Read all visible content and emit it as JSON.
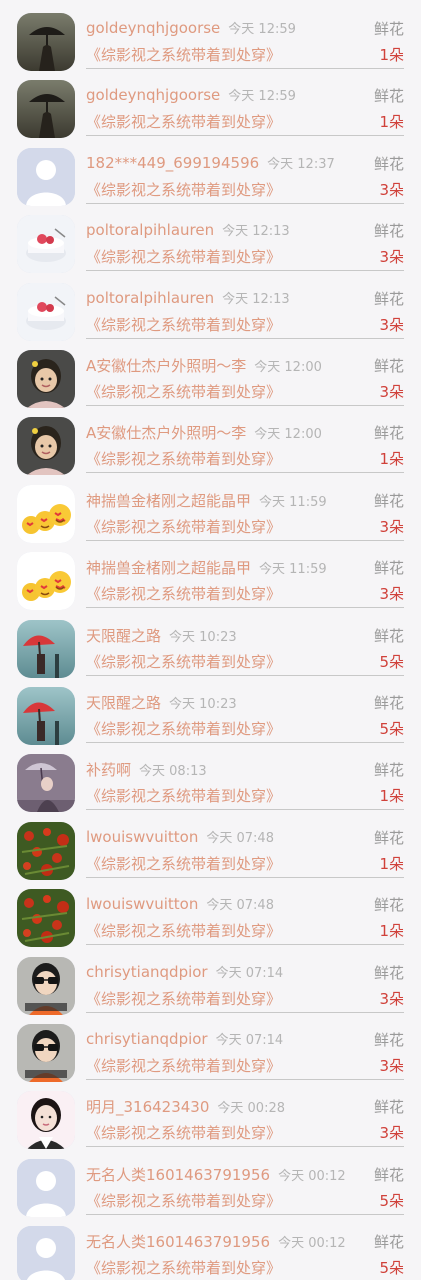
{
  "gift_label": "鲜花",
  "rows": [
    {
      "avatar": "avatar-umbrella-dark",
      "name": "goldeynqhjgoorse",
      "time": "今天 12:59",
      "book": "《综影视之系统带着到处穿》",
      "count": "1朵"
    },
    {
      "avatar": "avatar-umbrella-dark",
      "name": "goldeynqhjgoorse",
      "time": "今天 12:59",
      "book": "《综影视之系统带着到处穿》",
      "count": "1朵"
    },
    {
      "avatar": "avatar-default",
      "name": "182***449_699194596",
      "time": "今天 12:37",
      "book": "《综影视之系统带着到处穿》",
      "count": "3朵"
    },
    {
      "avatar": "avatar-cake",
      "name": "poltoralpihlauren",
      "time": "今天 12:13",
      "book": "《综影视之系统带着到处穿》",
      "count": "3朵"
    },
    {
      "avatar": "avatar-cake",
      "name": "poltoralpihlauren",
      "time": "今天 12:13",
      "book": "《综影视之系统带着到处穿》",
      "count": "3朵"
    },
    {
      "avatar": "avatar-girl-portrait",
      "name": "A安徽仕杰户外照明～李",
      "time": "今天 12:00",
      "book": "《综影视之系统带着到处穿》",
      "count": "3朵"
    },
    {
      "avatar": "avatar-girl-portrait",
      "name": "A安徽仕杰户外照明～李",
      "time": "今天 12:00",
      "book": "《综影视之系统带着到处穿》",
      "count": "1朵"
    },
    {
      "avatar": "avatar-emoji",
      "name": "神揣兽金楮刚之超能晶甲",
      "time": "今天 11:59",
      "book": "《综影视之系统带着到处穿》",
      "count": "3朵"
    },
    {
      "avatar": "avatar-emoji",
      "name": "神揣兽金楮刚之超能晶甲",
      "time": "今天 11:59",
      "book": "《综影视之系统带着到处穿》",
      "count": "3朵"
    },
    {
      "avatar": "avatar-red-umbrella",
      "name": "天限醒之路",
      "time": "今天 10:23",
      "book": "《综影视之系统带着到处穿》",
      "count": "5朵"
    },
    {
      "avatar": "avatar-red-umbrella",
      "name": "天限醒之路",
      "time": "今天 10:23",
      "book": "《综影视之系统带着到处穿》",
      "count": "5朵"
    },
    {
      "avatar": "avatar-lady-umbrella",
      "name": "补药啊",
      "time": "今天 08:13",
      "book": "《综影视之系统带着到处穿》",
      "count": "1朵"
    },
    {
      "avatar": "avatar-red-flowers",
      "name": "lwouiswvuitton",
      "time": "今天 07:48",
      "book": "《综影视之系统带着到处穿》",
      "count": "1朵"
    },
    {
      "avatar": "avatar-red-flowers",
      "name": "lwouiswvuitton",
      "time": "今天 07:48",
      "book": "《综影视之系统带着到处穿》",
      "count": "1朵"
    },
    {
      "avatar": "avatar-sunglasses",
      "name": "chrisytianqdpior",
      "time": "今天 07:14",
      "book": "《综影视之系统带着到处穿》",
      "count": "3朵"
    },
    {
      "avatar": "avatar-sunglasses",
      "name": "chrisytianqdpior",
      "time": "今天 07:14",
      "book": "《综影视之系统带着到处穿》",
      "count": "3朵"
    },
    {
      "avatar": "avatar-girl-white",
      "name": "明月_316423430",
      "time": "今天 00:28",
      "book": "《综影视之系统带着到处穿》",
      "count": "3朵"
    },
    {
      "avatar": "avatar-default",
      "name": "无名人类1601463791956",
      "time": "今天 00:12",
      "book": "《综影视之系统带着到处穿》",
      "count": "5朵"
    },
    {
      "avatar": "avatar-default",
      "name": "无名人类1601463791956",
      "time": "今天 00:12",
      "book": "《综影视之系统带着到处穿》",
      "count": "5朵"
    }
  ]
}
